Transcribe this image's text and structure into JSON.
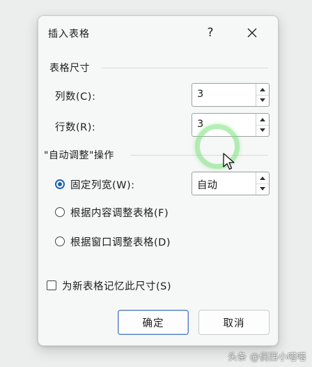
{
  "dialog": {
    "title": "插入表格",
    "help_label": "?"
  },
  "table_size": {
    "section_label": "表格尺寸",
    "columns_label": "列数(C):",
    "columns_value": "3",
    "rows_label": "行数(R):",
    "rows_value": "3"
  },
  "autofit": {
    "section_label": "\"自动调整\"操作",
    "options": [
      {
        "label": "固定列宽(W):",
        "checked": true
      },
      {
        "label": "根据内容调整表格(F)",
        "checked": false
      },
      {
        "label": "根据窗口调整表格(D)",
        "checked": false
      }
    ],
    "fixed_width_value": "自动"
  },
  "remember": {
    "label": "为新表格记忆此尺寸(S)",
    "checked": false
  },
  "buttons": {
    "ok": "确定",
    "cancel": "取消"
  },
  "watermark": "头条 @偶西小嗒嗒",
  "colors": {
    "accent": "#1f5fb4",
    "highlight_ring": "#78e278"
  },
  "icons": [
    "close-icon",
    "chevron-up-icon",
    "chevron-down-icon",
    "mouse-cursor-icon"
  ]
}
